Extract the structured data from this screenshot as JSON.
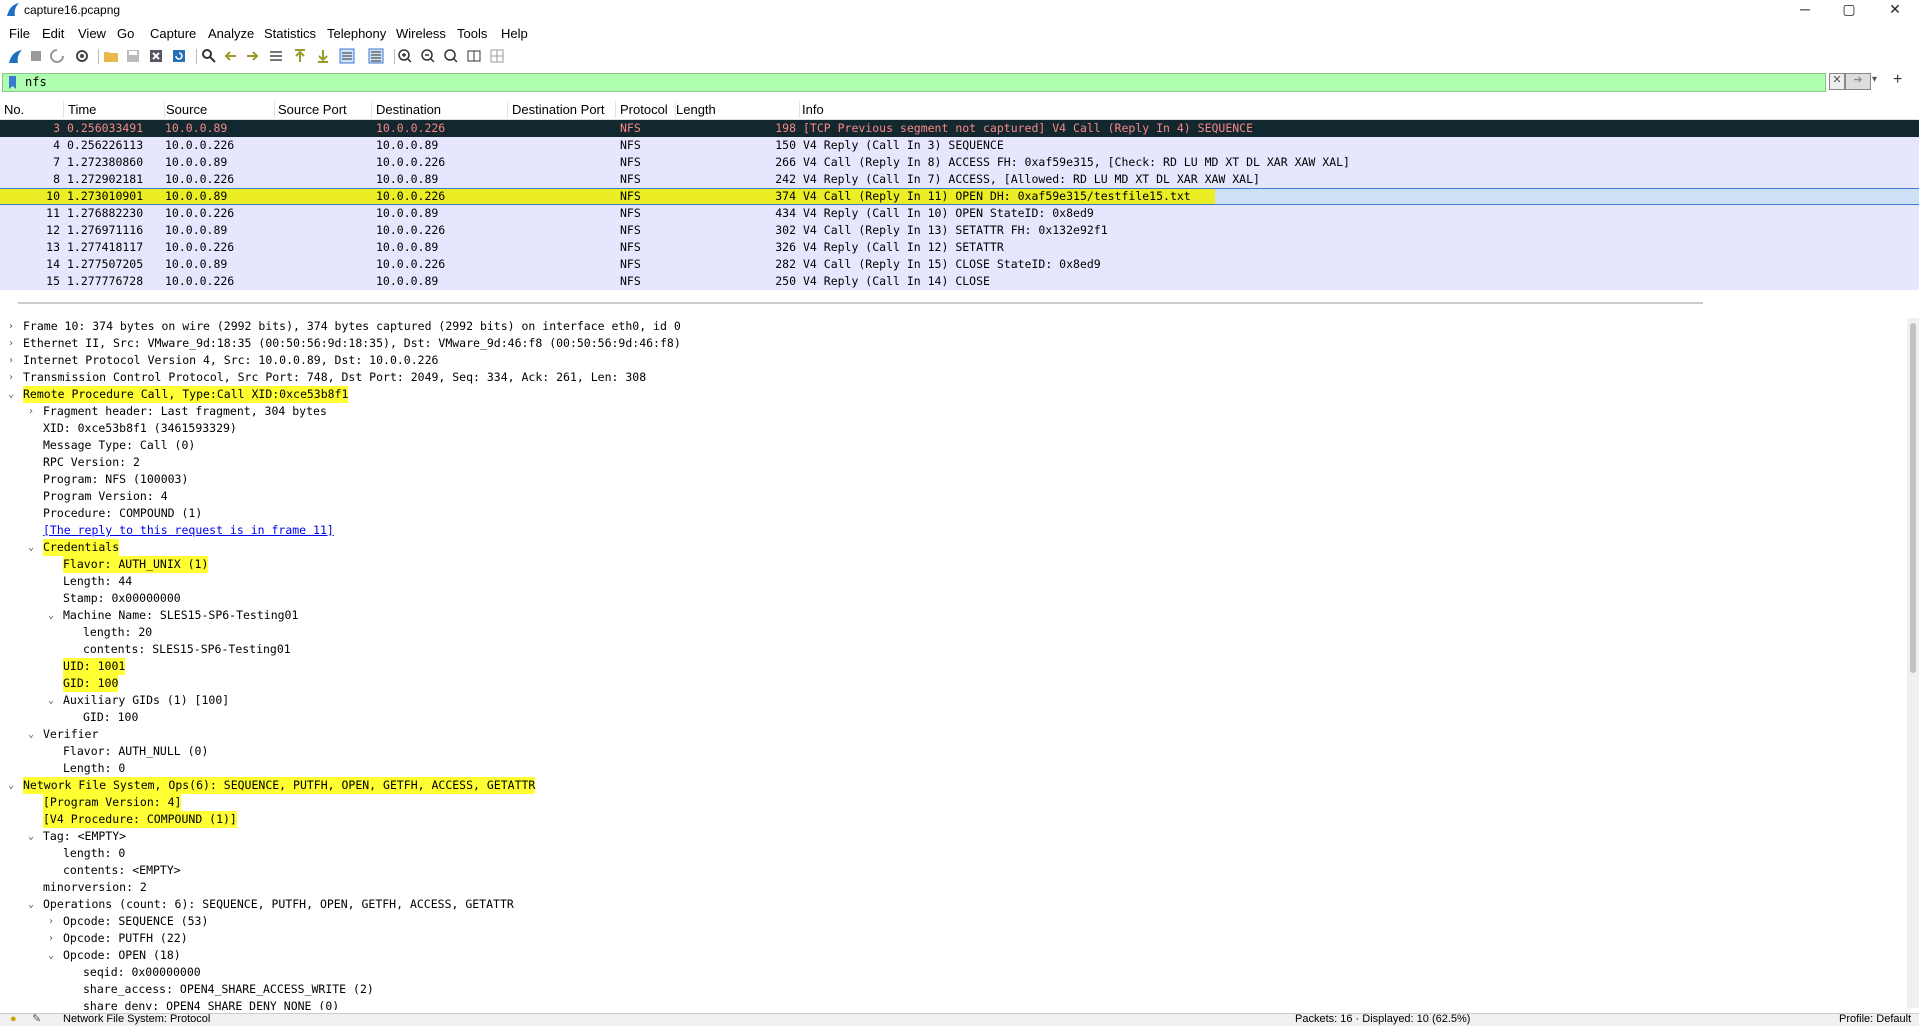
{
  "window": {
    "title": "capture16.pcapng",
    "controls": {
      "minimize": "─",
      "maximize": "▢",
      "close": "✕"
    }
  },
  "menu": [
    "File",
    "Edit",
    "View",
    "Go",
    "Capture",
    "Analyze",
    "Statistics",
    "Telephony",
    "Wireless",
    "Tools",
    "Help"
  ],
  "toolbar": {
    "icons": [
      "shark-fin-start-icon",
      "stop-icon",
      "restart-icon",
      "options-gear-icon",
      "open-folder-icon",
      "save-icon",
      "close-file-icon",
      "reload-icon",
      "find-icon",
      "back-icon",
      "forward-icon",
      "go-to-packet-icon",
      "first-packet-icon",
      "last-packet-icon",
      "autoscroll-icon",
      "colorize-icon",
      "zoom-in-icon",
      "zoom-out-icon",
      "normal-size-icon",
      "resize-columns-icon",
      "layout-icon"
    ]
  },
  "filter": {
    "value": "nfs",
    "clear_label": "✕",
    "apply_label": "➔",
    "dropdown_label": "▾",
    "add_label": "+"
  },
  "packet_list": {
    "columns": [
      "No.",
      "Time",
      "Source",
      "Source Port",
      "Destination",
      "Destination Port",
      "Protocol",
      "Length",
      "Info"
    ],
    "rows": [
      {
        "no": "3",
        "time": "0.256033491",
        "src": "10.0.0.89",
        "sport": "",
        "dst": "10.0.0.226",
        "dport": "",
        "proto": "NFS",
        "len": "198",
        "info": "[TCP Previous segment not captured] V4 Call (Reply In 4) SEQUENCE",
        "style": "dark"
      },
      {
        "no": "4",
        "time": "0.256226113",
        "src": "10.0.0.226",
        "sport": "",
        "dst": "10.0.0.89",
        "dport": "",
        "proto": "NFS",
        "len": "150",
        "info": "V4 Reply (Call In 3) SEQUENCE",
        "style": "normal"
      },
      {
        "no": "7",
        "time": "1.272380860",
        "src": "10.0.0.89",
        "sport": "",
        "dst": "10.0.0.226",
        "dport": "",
        "proto": "NFS",
        "len": "266",
        "info": "V4 Call (Reply In 8) ACCESS FH: 0xaf59e315, [Check: RD LU MD XT DL XAR XAW XAL]",
        "style": "normal"
      },
      {
        "no": "8",
        "time": "1.272902181",
        "src": "10.0.0.226",
        "sport": "",
        "dst": "10.0.0.89",
        "dport": "",
        "proto": "NFS",
        "len": "242",
        "info": "V4 Reply (Call In 7) ACCESS, [Allowed: RD LU MD XT DL XAR XAW XAL]",
        "style": "normal"
      },
      {
        "no": "10",
        "time": "1.273010901",
        "src": "10.0.0.89",
        "sport": "",
        "dst": "10.0.0.226",
        "dport": "",
        "proto": "NFS",
        "len": "374",
        "info": "V4 Call (Reply In 11) OPEN DH: 0xaf59e315/testfile15.txt",
        "style": "selected"
      },
      {
        "no": "11",
        "time": "1.276882230",
        "src": "10.0.0.226",
        "sport": "",
        "dst": "10.0.0.89",
        "dport": "",
        "proto": "NFS",
        "len": "434",
        "info": "V4 Reply (Call In 10) OPEN StateID: 0x8ed9",
        "style": "normal"
      },
      {
        "no": "12",
        "time": "1.276971116",
        "src": "10.0.0.89",
        "sport": "",
        "dst": "10.0.0.226",
        "dport": "",
        "proto": "NFS",
        "len": "302",
        "info": "V4 Call (Reply In 13) SETATTR FH: 0x132e92f1",
        "style": "normal"
      },
      {
        "no": "13",
        "time": "1.277418117",
        "src": "10.0.0.226",
        "sport": "",
        "dst": "10.0.0.89",
        "dport": "",
        "proto": "NFS",
        "len": "326",
        "info": "V4 Reply (Call In 12) SETATTR",
        "style": "normal"
      },
      {
        "no": "14",
        "time": "1.277507205",
        "src": "10.0.0.89",
        "sport": "",
        "dst": "10.0.0.226",
        "dport": "",
        "proto": "NFS",
        "len": "282",
        "info": "V4 Call (Reply In 15) CLOSE StateID: 0x8ed9",
        "style": "normal"
      },
      {
        "no": "15",
        "time": "1.277776728",
        "src": "10.0.0.226",
        "sport": "",
        "dst": "10.0.0.89",
        "dport": "",
        "proto": "NFS",
        "len": "250",
        "info": "V4 Reply (Call In 14) CLOSE",
        "style": "normal"
      }
    ]
  },
  "details": [
    {
      "indent": 0,
      "arrow": "›",
      "text": "Frame 10: 374 bytes on wire (2992 bits), 374 bytes captured (2992 bits) on interface eth0, id 0",
      "hl": false
    },
    {
      "indent": 0,
      "arrow": "›",
      "text": "Ethernet II, Src: VMware_9d:18:35 (00:50:56:9d:18:35), Dst: VMware_9d:46:f8 (00:50:56:9d:46:f8)",
      "hl": false
    },
    {
      "indent": 0,
      "arrow": "›",
      "text": "Internet Protocol Version 4, Src: 10.0.0.89, Dst: 10.0.0.226",
      "hl": false
    },
    {
      "indent": 0,
      "arrow": "›",
      "text": "Transmission Control Protocol, Src Port: 748, Dst Port: 2049, Seq: 334, Ack: 261, Len: 308",
      "hl": false
    },
    {
      "indent": 0,
      "arrow": "⌄",
      "text": "Remote Procedure Call, Type:Call XID:0xce53b8f1",
      "hl": true
    },
    {
      "indent": 1,
      "arrow": "›",
      "text": "Fragment header: Last fragment, 304 bytes",
      "hl": false
    },
    {
      "indent": 1,
      "arrow": "",
      "text": "XID: 0xce53b8f1 (3461593329)",
      "hl": false
    },
    {
      "indent": 1,
      "arrow": "",
      "text": "Message Type: Call (0)",
      "hl": false
    },
    {
      "indent": 1,
      "arrow": "",
      "text": "RPC Version: 2",
      "hl": false
    },
    {
      "indent": 1,
      "arrow": "",
      "text": "Program: NFS (100003)",
      "hl": false
    },
    {
      "indent": 1,
      "arrow": "",
      "text": "Program Version: 4",
      "hl": false
    },
    {
      "indent": 1,
      "arrow": "",
      "text": "Procedure: COMPOUND (1)",
      "hl": false
    },
    {
      "indent": 1,
      "arrow": "",
      "text": "[The reply to this request is in frame 11]",
      "hl": false,
      "link": true
    },
    {
      "indent": 1,
      "arrow": "⌄",
      "text": "Credentials",
      "hl": true
    },
    {
      "indent": 2,
      "arrow": "",
      "text": "Flavor: AUTH_UNIX (1)",
      "hl": true
    },
    {
      "indent": 2,
      "arrow": "",
      "text": "Length: 44",
      "hl": false
    },
    {
      "indent": 2,
      "arrow": "",
      "text": "Stamp: 0x00000000",
      "hl": false
    },
    {
      "indent": 2,
      "arrow": "⌄",
      "text": "Machine Name: SLES15-SP6-Testing01",
      "hl": false
    },
    {
      "indent": 3,
      "arrow": "",
      "text": "length: 20",
      "hl": false
    },
    {
      "indent": 3,
      "arrow": "",
      "text": "contents: SLES15-SP6-Testing01",
      "hl": false
    },
    {
      "indent": 2,
      "arrow": "",
      "text": "UID: 1001",
      "hl": true
    },
    {
      "indent": 2,
      "arrow": "",
      "text": "GID: 100",
      "hl": true
    },
    {
      "indent": 2,
      "arrow": "⌄",
      "text": "Auxiliary GIDs (1) [100]",
      "hl": false
    },
    {
      "indent": 3,
      "arrow": "",
      "text": "GID: 100",
      "hl": false
    },
    {
      "indent": 1,
      "arrow": "⌄",
      "text": "Verifier",
      "hl": false
    },
    {
      "indent": 2,
      "arrow": "",
      "text": "Flavor: AUTH_NULL (0)",
      "hl": false
    },
    {
      "indent": 2,
      "arrow": "",
      "text": "Length: 0",
      "hl": false
    },
    {
      "indent": 0,
      "arrow": "⌄",
      "text": "Network File System, Ops(6): SEQUENCE, PUTFH, OPEN, GETFH, ACCESS, GETATTR",
      "hl": true
    },
    {
      "indent": 1,
      "arrow": "",
      "text": "[Program Version: 4]",
      "hl": true
    },
    {
      "indent": 1,
      "arrow": "",
      "text": "[V4 Procedure: COMPOUND (1)]",
      "hl": true
    },
    {
      "indent": 1,
      "arrow": "⌄",
      "text": "Tag: <EMPTY>",
      "hl": false
    },
    {
      "indent": 2,
      "arrow": "",
      "text": "length: 0",
      "hl": false
    },
    {
      "indent": 2,
      "arrow": "",
      "text": "contents: <EMPTY>",
      "hl": false
    },
    {
      "indent": 1,
      "arrow": "",
      "text": "minorversion: 2",
      "hl": false
    },
    {
      "indent": 1,
      "arrow": "⌄",
      "text": "Operations (count: 6): SEQUENCE, PUTFH, OPEN, GETFH, ACCESS, GETATTR",
      "hl": false
    },
    {
      "indent": 2,
      "arrow": "›",
      "text": "Opcode: SEQUENCE (53)",
      "hl": false
    },
    {
      "indent": 2,
      "arrow": "›",
      "text": "Opcode: PUTFH (22)",
      "hl": false
    },
    {
      "indent": 2,
      "arrow": "⌄",
      "text": "Opcode: OPEN (18)",
      "hl": false
    },
    {
      "indent": 3,
      "arrow": "",
      "text": "seqid: 0x00000000",
      "hl": false
    },
    {
      "indent": 3,
      "arrow": "",
      "text": "share_access: OPEN4_SHARE_ACCESS_WRITE (2)",
      "hl": false
    },
    {
      "indent": 3,
      "arrow": "",
      "text": "share_deny: OPEN4_SHARE_DENY_NONE (0)",
      "hl": false
    }
  ],
  "status": {
    "left_text": "Network File System: Protocol",
    "packets_text": "Packets: 16 · Displayed: 10 (62.5%)",
    "profile_text": "Profile: Default"
  },
  "colors": {
    "accent": "#3d7ad1",
    "row_bg": "#e7e6ff",
    "row_dark_bg": "#12272e",
    "row_dark_fg": "#f78787",
    "filter_bg": "#b0ffb0",
    "highlight": "#ffff33"
  }
}
